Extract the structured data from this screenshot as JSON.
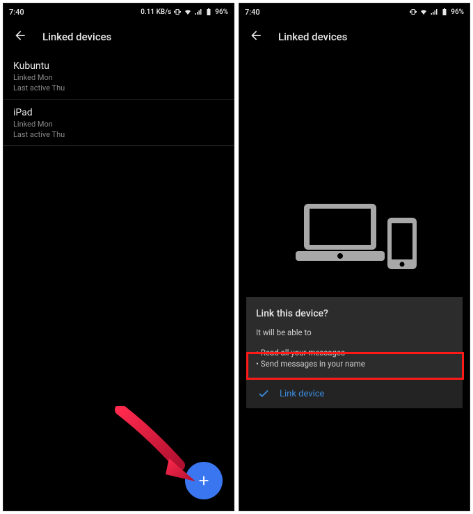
{
  "status": {
    "time": "7:40",
    "net_label": "0.11 KB/s",
    "battery": "96%"
  },
  "left": {
    "title": "Linked devices",
    "devices": [
      {
        "name": "Kubuntu",
        "linked": "Linked Mon",
        "active": "Last active Thu"
      },
      {
        "name": "iPad",
        "linked": "Linked Mon",
        "active": "Last active Thu"
      }
    ]
  },
  "right": {
    "title": "Linked devices",
    "card_title": "Link this device?",
    "card_subtitle": "It will be able to",
    "bullets": [
      "• Read all your messages",
      "• Send messages in your name"
    ],
    "link_label": "Link device"
  }
}
